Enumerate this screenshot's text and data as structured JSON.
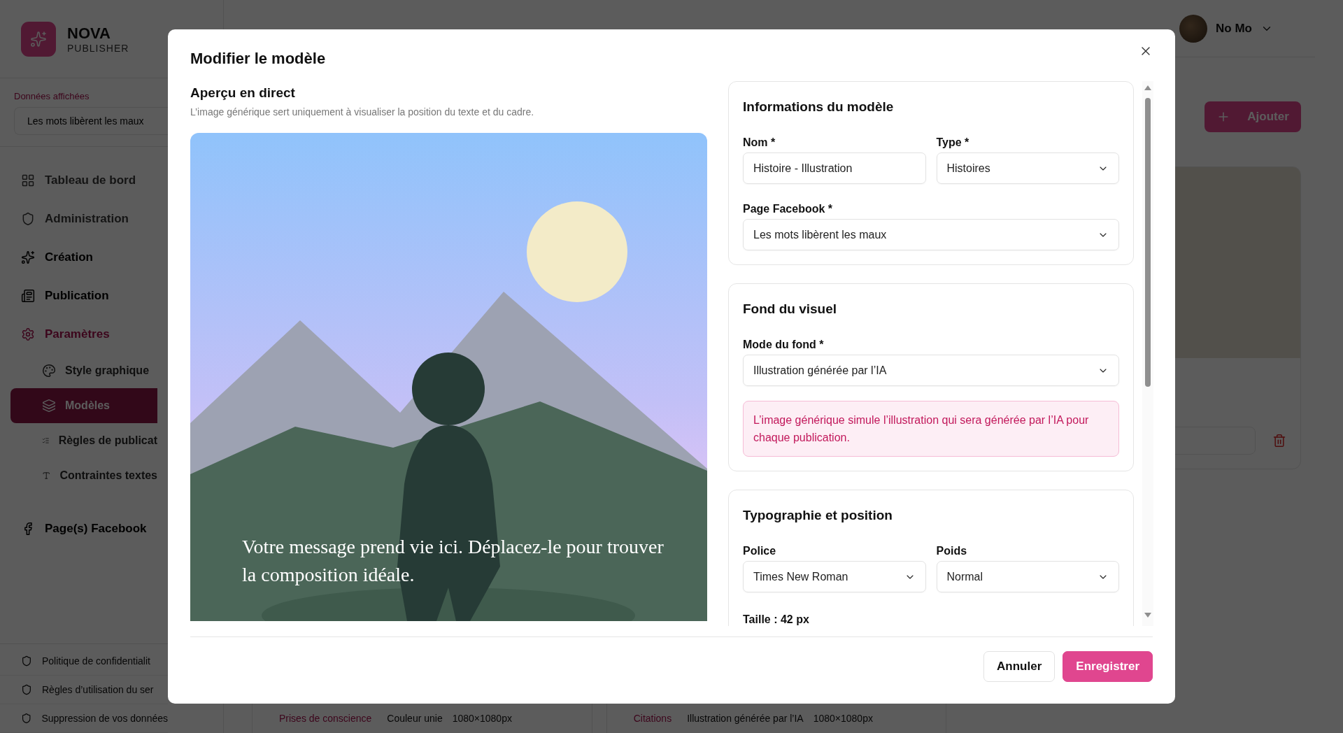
{
  "sidebar": {
    "brand": {
      "name": "NOVA",
      "tagline": "PUBLISHER"
    },
    "data_label": "Données affichées",
    "data_select": {
      "value": "Les mots libèrent les maux"
    },
    "nav": [
      {
        "label": "Tableau de bord",
        "disabled": true,
        "selected": false
      },
      {
        "label": "Administration",
        "disabled": true,
        "selected": false
      },
      {
        "label": "Création",
        "disabled": false,
        "selected": false
      },
      {
        "label": "Publication",
        "disabled": false,
        "selected": false
      },
      {
        "label": "Paramètres",
        "disabled": false,
        "selected": true,
        "children": [
          {
            "label": "Style graphique",
            "selected": false
          },
          {
            "label": "Modèles",
            "selected": true
          },
          {
            "label": "Règles de publicat",
            "selected": false
          },
          {
            "label": "Contraintes textes",
            "selected": false
          }
        ]
      }
    ],
    "nav_bottom": [
      {
        "label": "Page(s) Facebook",
        "disabled": false,
        "selected": false
      }
    ],
    "footer_links": [
      "Politique de confidentialit",
      "Règles d’utilisation du ser",
      "Suppression de vos données"
    ]
  },
  "header": {
    "user": {
      "name": "No Mo"
    }
  },
  "toolbar": {
    "add_button": "Ajouter"
  },
  "template_cards": [
    {
      "tag": "Prises de conscience",
      "mode": "Couleur unie",
      "size": "1080×1080px"
    },
    {
      "tag": "Citations",
      "mode": "Illustration générée par l’IA",
      "size": "1080×1080px"
    }
  ],
  "modal": {
    "title": "Modifier le modèle",
    "preview": {
      "heading": "Aperçu en direct",
      "note": "L’image générique sert uniquement à visualiser la position du texte et du cadre.",
      "overlay_text": "Votre message prend vie ici. Déplacez-le pour trouver la composition idéale."
    },
    "sections": [
      {
        "title": "Informations du modèle",
        "rows": [
          [
            {
              "kind": "input",
              "label": "Nom *",
              "value": "Histoire - Illustration"
            },
            {
              "kind": "select",
              "label": "Type *",
              "value": "Histoires"
            }
          ],
          [
            {
              "kind": "select",
              "label": "Page Facebook *",
              "value": "Les mots libèrent les maux"
            }
          ]
        ]
      },
      {
        "title": "Fond du visuel",
        "rows": [
          [
            {
              "kind": "select",
              "label": "Mode du fond *",
              "value": "Illustration générée par l’IA"
            }
          ],
          [
            {
              "kind": "notice",
              "text": "L’image générique simule l’illustration qui sera générée par l’IA pour chaque publication."
            }
          ]
        ]
      },
      {
        "title": "Typographie et position",
        "rows": [
          [
            {
              "kind": "select",
              "label": "Police",
              "value": "Times New Roman"
            },
            {
              "kind": "select",
              "label": "Poids",
              "value": "Normal"
            }
          ],
          [
            {
              "kind": "caption",
              "text": "Taille : 42 px"
            }
          ]
        ]
      }
    ],
    "buttons": [
      {
        "kind": "secondary",
        "label": "Annuler"
      },
      {
        "kind": "primary",
        "label": "Enregistrer"
      }
    ]
  }
}
